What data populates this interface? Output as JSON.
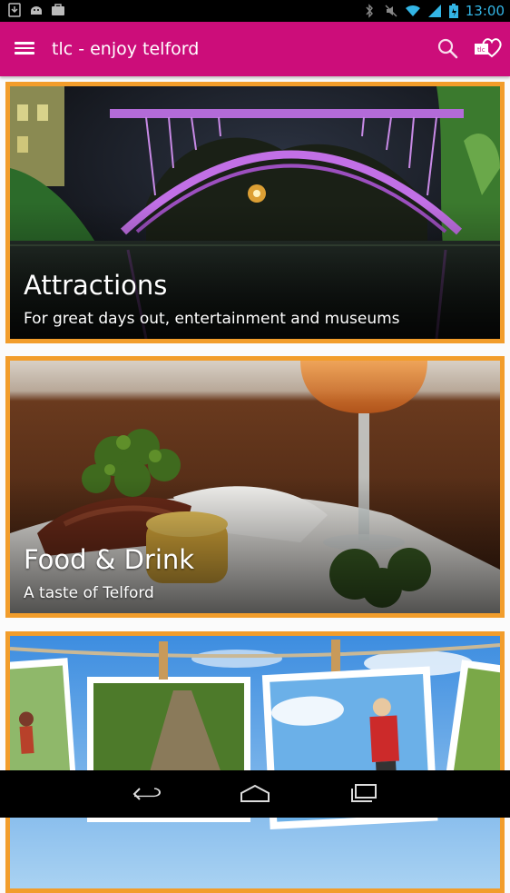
{
  "status_bar": {
    "time": "13:00",
    "left_icons": [
      "download-icon",
      "android-icon",
      "briefcase-icon"
    ],
    "right_icons": [
      "bluetooth-icon",
      "mute-icon",
      "wifi-icon",
      "signal-icon",
      "battery-icon"
    ]
  },
  "app_bar": {
    "title": "tlc - enjoy telford",
    "background": "#cc0d7a",
    "menu_icon": "menu-icon",
    "search_icon": "search-icon",
    "logo": "tlc-heart-logo"
  },
  "cards": [
    {
      "title": "Attractions",
      "subtitle": "For great days out, entertainment and museums",
      "image": "iron-bridge-night"
    },
    {
      "title": "Food & Drink",
      "subtitle": "A taste of Telford",
      "image": "plated-dish-wine"
    },
    {
      "title": "",
      "subtitle": "",
      "image": "photos-on-clothesline"
    }
  ],
  "card_border_color": "#f29d2b",
  "nav_bar": {
    "icons": [
      "back-icon",
      "home-icon",
      "recents-icon"
    ]
  }
}
